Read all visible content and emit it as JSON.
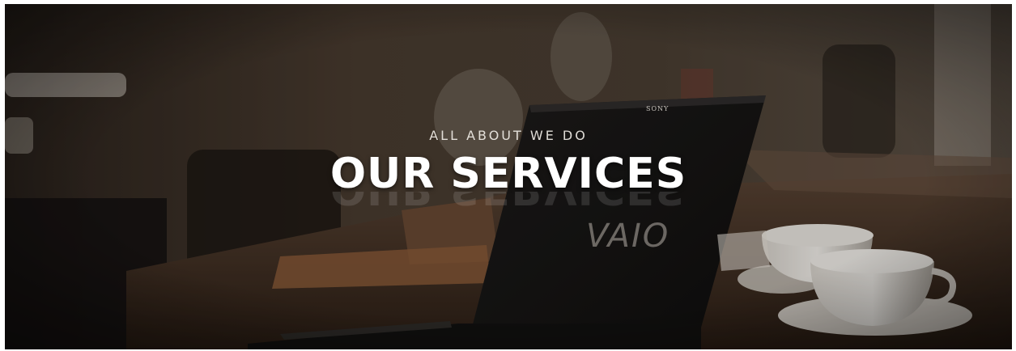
{
  "hero": {
    "eyebrow": "ALL ABOUT WE DO",
    "title": "OUR SERVICES",
    "laptop_brand": "SONY",
    "laptop_logo": "VAIO"
  },
  "colors": {
    "background": "#3a2f26",
    "title": "#ffffff",
    "eyebrow": "#f0ece6"
  }
}
